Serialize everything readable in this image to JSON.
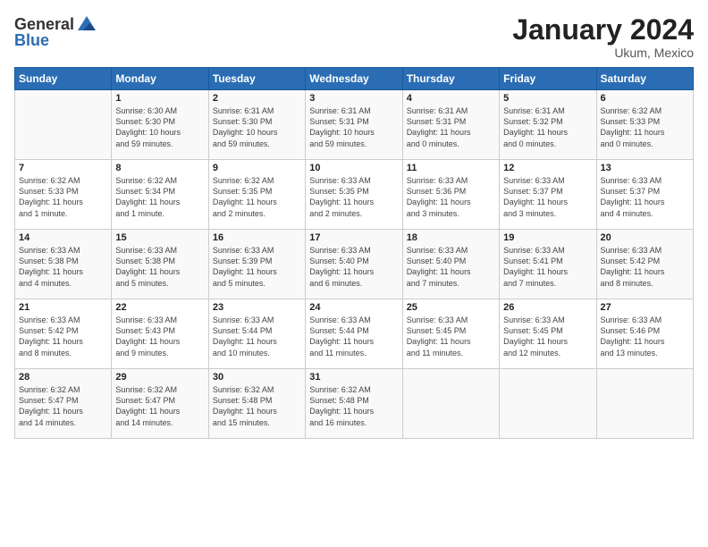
{
  "header": {
    "logo_line1": "General",
    "logo_line2": "Blue",
    "month_title": "January 2024",
    "location": "Ukum, Mexico"
  },
  "weekdays": [
    "Sunday",
    "Monday",
    "Tuesday",
    "Wednesday",
    "Thursday",
    "Friday",
    "Saturday"
  ],
  "weeks": [
    [
      {
        "day": "",
        "info": ""
      },
      {
        "day": "1",
        "info": "Sunrise: 6:30 AM\nSunset: 5:30 PM\nDaylight: 10 hours\nand 59 minutes."
      },
      {
        "day": "2",
        "info": "Sunrise: 6:31 AM\nSunset: 5:30 PM\nDaylight: 10 hours\nand 59 minutes."
      },
      {
        "day": "3",
        "info": "Sunrise: 6:31 AM\nSunset: 5:31 PM\nDaylight: 10 hours\nand 59 minutes."
      },
      {
        "day": "4",
        "info": "Sunrise: 6:31 AM\nSunset: 5:31 PM\nDaylight: 11 hours\nand 0 minutes."
      },
      {
        "day": "5",
        "info": "Sunrise: 6:31 AM\nSunset: 5:32 PM\nDaylight: 11 hours\nand 0 minutes."
      },
      {
        "day": "6",
        "info": "Sunrise: 6:32 AM\nSunset: 5:33 PM\nDaylight: 11 hours\nand 0 minutes."
      }
    ],
    [
      {
        "day": "7",
        "info": "Sunrise: 6:32 AM\nSunset: 5:33 PM\nDaylight: 11 hours\nand 1 minute."
      },
      {
        "day": "8",
        "info": "Sunrise: 6:32 AM\nSunset: 5:34 PM\nDaylight: 11 hours\nand 1 minute."
      },
      {
        "day": "9",
        "info": "Sunrise: 6:32 AM\nSunset: 5:35 PM\nDaylight: 11 hours\nand 2 minutes."
      },
      {
        "day": "10",
        "info": "Sunrise: 6:33 AM\nSunset: 5:35 PM\nDaylight: 11 hours\nand 2 minutes."
      },
      {
        "day": "11",
        "info": "Sunrise: 6:33 AM\nSunset: 5:36 PM\nDaylight: 11 hours\nand 3 minutes."
      },
      {
        "day": "12",
        "info": "Sunrise: 6:33 AM\nSunset: 5:37 PM\nDaylight: 11 hours\nand 3 minutes."
      },
      {
        "day": "13",
        "info": "Sunrise: 6:33 AM\nSunset: 5:37 PM\nDaylight: 11 hours\nand 4 minutes."
      }
    ],
    [
      {
        "day": "14",
        "info": "Sunrise: 6:33 AM\nSunset: 5:38 PM\nDaylight: 11 hours\nand 4 minutes."
      },
      {
        "day": "15",
        "info": "Sunrise: 6:33 AM\nSunset: 5:38 PM\nDaylight: 11 hours\nand 5 minutes."
      },
      {
        "day": "16",
        "info": "Sunrise: 6:33 AM\nSunset: 5:39 PM\nDaylight: 11 hours\nand 5 minutes."
      },
      {
        "day": "17",
        "info": "Sunrise: 6:33 AM\nSunset: 5:40 PM\nDaylight: 11 hours\nand 6 minutes."
      },
      {
        "day": "18",
        "info": "Sunrise: 6:33 AM\nSunset: 5:40 PM\nDaylight: 11 hours\nand 7 minutes."
      },
      {
        "day": "19",
        "info": "Sunrise: 6:33 AM\nSunset: 5:41 PM\nDaylight: 11 hours\nand 7 minutes."
      },
      {
        "day": "20",
        "info": "Sunrise: 6:33 AM\nSunset: 5:42 PM\nDaylight: 11 hours\nand 8 minutes."
      }
    ],
    [
      {
        "day": "21",
        "info": "Sunrise: 6:33 AM\nSunset: 5:42 PM\nDaylight: 11 hours\nand 8 minutes."
      },
      {
        "day": "22",
        "info": "Sunrise: 6:33 AM\nSunset: 5:43 PM\nDaylight: 11 hours\nand 9 minutes."
      },
      {
        "day": "23",
        "info": "Sunrise: 6:33 AM\nSunset: 5:44 PM\nDaylight: 11 hours\nand 10 minutes."
      },
      {
        "day": "24",
        "info": "Sunrise: 6:33 AM\nSunset: 5:44 PM\nDaylight: 11 hours\nand 11 minutes."
      },
      {
        "day": "25",
        "info": "Sunrise: 6:33 AM\nSunset: 5:45 PM\nDaylight: 11 hours\nand 11 minutes."
      },
      {
        "day": "26",
        "info": "Sunrise: 6:33 AM\nSunset: 5:45 PM\nDaylight: 11 hours\nand 12 minutes."
      },
      {
        "day": "27",
        "info": "Sunrise: 6:33 AM\nSunset: 5:46 PM\nDaylight: 11 hours\nand 13 minutes."
      }
    ],
    [
      {
        "day": "28",
        "info": "Sunrise: 6:32 AM\nSunset: 5:47 PM\nDaylight: 11 hours\nand 14 minutes."
      },
      {
        "day": "29",
        "info": "Sunrise: 6:32 AM\nSunset: 5:47 PM\nDaylight: 11 hours\nand 14 minutes."
      },
      {
        "day": "30",
        "info": "Sunrise: 6:32 AM\nSunset: 5:48 PM\nDaylight: 11 hours\nand 15 minutes."
      },
      {
        "day": "31",
        "info": "Sunrise: 6:32 AM\nSunset: 5:48 PM\nDaylight: 11 hours\nand 16 minutes."
      },
      {
        "day": "",
        "info": ""
      },
      {
        "day": "",
        "info": ""
      },
      {
        "day": "",
        "info": ""
      }
    ]
  ]
}
